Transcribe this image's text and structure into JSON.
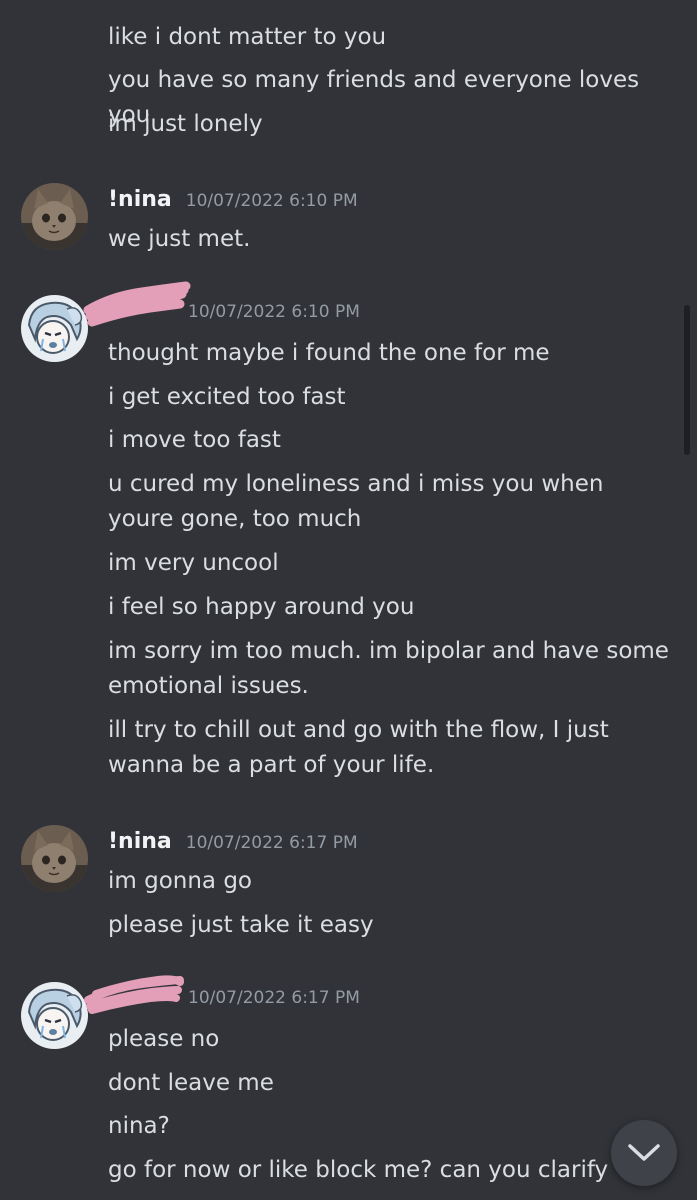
{
  "previous_messages": {
    "cut_off_line": "",
    "lines": [
      "like i dont matter to you",
      "you have so many friends and everyone loves you",
      "im just lonely"
    ]
  },
  "groups": [
    {
      "author": "!nina",
      "timestamp": "10/07/2022 6:10 PM",
      "avatar_icon": "cat-avatar",
      "lines": [
        "we just met."
      ]
    },
    {
      "author": "",
      "author_redacted": true,
      "timestamp": "10/07/2022 6:10 PM",
      "avatar_icon": "anime-avatar",
      "lines": [
        "thought maybe i found the one for me",
        "i get excited too fast",
        "i move too fast",
        "u cured my loneliness and i miss you when youre gone, too much",
        "im very uncool",
        "i feel so happy around you",
        "im sorry im too much. im bipolar and have some emotional issues.",
        "ill try to chill out and go with the flow, I just wanna be a part of your life."
      ]
    },
    {
      "author": "!nina",
      "timestamp": "10/07/2022 6:17 PM",
      "avatar_icon": "cat-avatar",
      "lines": [
        "im gonna go",
        "please just take it easy"
      ]
    },
    {
      "author": "",
      "author_redacted": true,
      "timestamp": "10/07/2022 6:17 PM",
      "avatar_icon": "anime-avatar",
      "lines": [
        "please no",
        "dont leave me",
        "nina?",
        "go for now or like block me? can you clarify"
      ]
    }
  ],
  "jump_button_icon": "chevron-down-icon",
  "colors": {
    "background": "#313338",
    "text": "#dbdee1",
    "username": "#f2f3f5",
    "timestamp": "#949ba4",
    "redaction_pink": "#f2a7c3"
  }
}
